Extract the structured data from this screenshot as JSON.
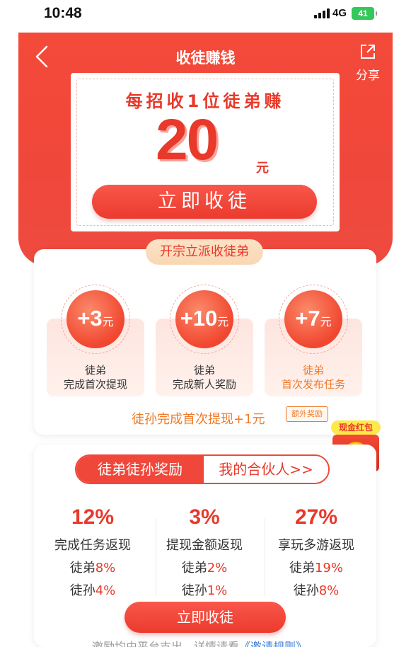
{
  "status_bar": {
    "time": "10:48",
    "network": "4G",
    "battery": "41"
  },
  "header": {
    "title": "收徒赚钱",
    "share_label": "分享"
  },
  "invite_card": {
    "reward_text": "每招收1位徒弟赚",
    "amount": "20",
    "unit": "元",
    "button_label": "立即收徒"
  },
  "tiers": {
    "tag": "开宗立派收徒弟",
    "items": [
      {
        "value": "+3",
        "unit": "元",
        "title": "徒弟",
        "desc": "完成首次提现"
      },
      {
        "value": "+10",
        "unit": "元",
        "title": "徒弟",
        "desc": "完成新人奖励"
      },
      {
        "value": "+7",
        "unit": "元",
        "title": "徒弟",
        "desc": "首次发布任务"
      }
    ],
    "bonus_text": "徒孙完成首次提现+1元",
    "bonus_tag": "额外奖励"
  },
  "red_packet": {
    "label": "现金红包",
    "coin": "领"
  },
  "rewards_panel": {
    "tabs": [
      {
        "label": "徒弟徒孙奖励"
      },
      {
        "label": "我的合伙人>>"
      }
    ],
    "stats": [
      {
        "percent": "12%",
        "desc": "完成任务返现",
        "line1_label": "徒弟",
        "line1_value": "8%",
        "line2_label": "徒孙",
        "line2_value": "4%"
      },
      {
        "percent": "3%",
        "desc": "提现金额返现",
        "line1_label": "徒弟",
        "line1_value": "2%",
        "line2_label": "徒孙",
        "line2_value": "1%"
      },
      {
        "percent": "27%",
        "desc": "享玩多游返现",
        "line1_label": "徒弟",
        "line1_value": "19%",
        "line2_label": "徒孙",
        "line2_value": "8%"
      }
    ],
    "button_label": "立即收徒",
    "footnote_text": "邀励均由平台支出，详情请看",
    "footnote_link": "《邀请规则》"
  },
  "colors": {
    "primary_red": "#f0473b",
    "accent_orange": "#ef7a2a",
    "link_blue": "#3a7bd5"
  }
}
